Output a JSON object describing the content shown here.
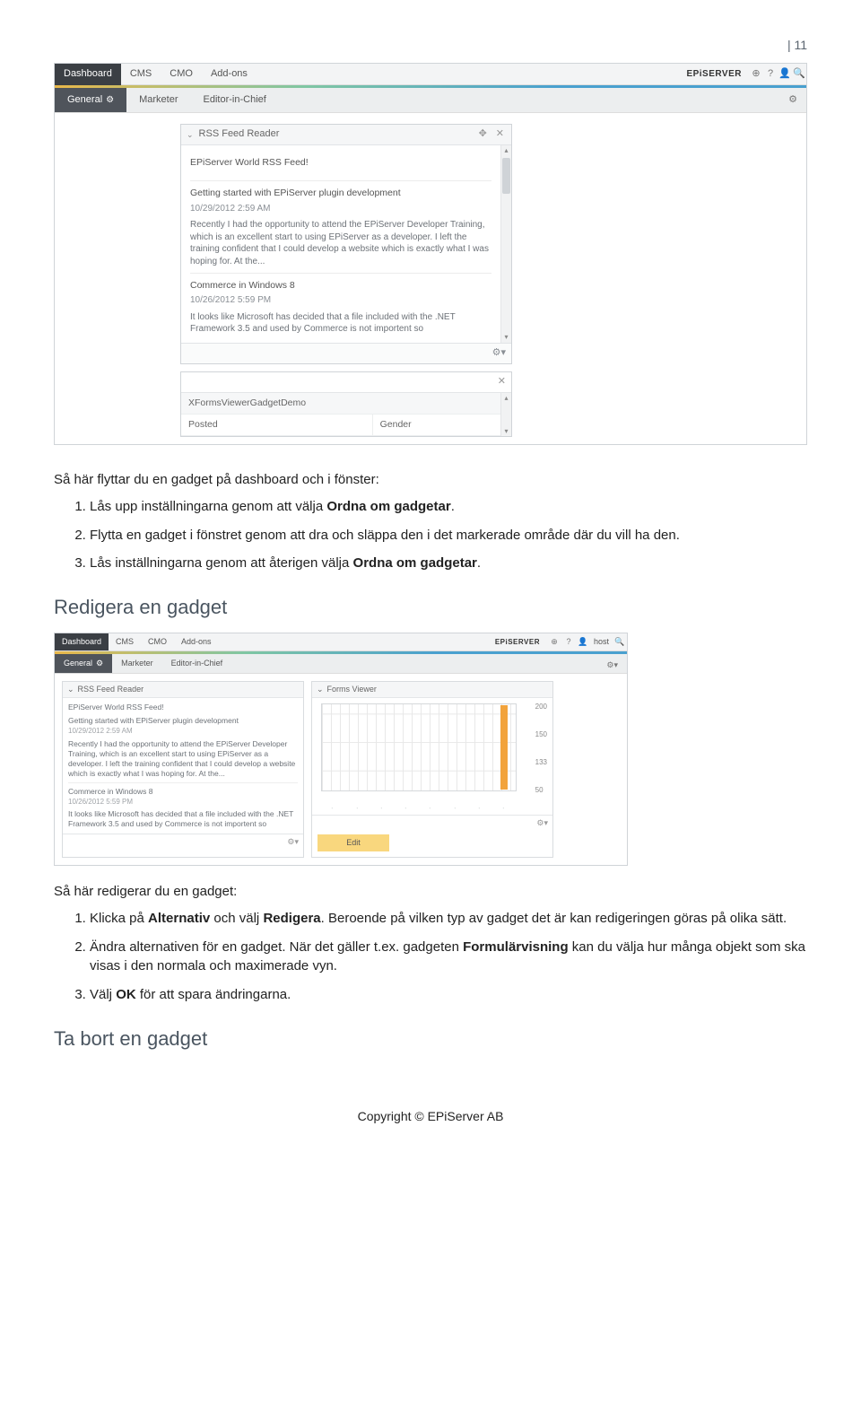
{
  "page_number": "| 11",
  "screenshot1": {
    "nav": {
      "dashboard": "Dashboard",
      "cms": "CMS",
      "cmo": "CMO",
      "addons": "Add-ons",
      "brand": "EPiSERVER"
    },
    "subnav": {
      "general": "General",
      "marketer": "Marketer",
      "editor": "Editor-in-Chief"
    },
    "panel": {
      "title": "RSS Feed Reader",
      "feed_title": "EPiServer World RSS Feed!",
      "item1_title": "Getting started with EPiServer plugin development",
      "item1_date": "10/29/2012 2:59 AM",
      "item1_text": "Recently I had the opportunity to attend the EPiServer Developer Training, which is an excellent start to using EPiServer as a developer.  I left the training confident that I could develop a website which is exactly what I was hoping for.  At the...",
      "item2_title": "Commerce in Windows 8",
      "item2_date": "10/26/2012 5:59 PM",
      "item2_text": "It looks like Microsoft has decided that a file included with the .NET Framework 3.5 and used by Commerce is not importent so"
    },
    "panel2": {
      "row1": "XFormsViewerGadgetDemo",
      "row2a": "Posted",
      "row2b": "Gender"
    }
  },
  "text": {
    "intro1": "Så här flyttar du en gadget på dashboard och i fönster:",
    "step1a": "Lås upp inställningarna genom att välja ",
    "step1b": "Ordna om gadgetar",
    "step1c": ".",
    "step2": "Flytta en gadget i fönstret genom att dra och släppa den i det markerade område där du vill ha den.",
    "step3a": "Lås inställningarna genom att återigen välja ",
    "step3b": "Ordna om gadgetar",
    "step3c": "."
  },
  "heading2": "Redigera en gadget",
  "screenshot2": {
    "nav": {
      "dashboard": "Dashboard",
      "cms": "CMS",
      "cmo": "CMO",
      "addons": "Add-ons",
      "brand": "EPiSERVER",
      "user": "host"
    },
    "subnav": {
      "general": "General",
      "marketer": "Marketer",
      "editor": "Editor-in-Chief"
    },
    "left_panel": {
      "title": "RSS Feed Reader",
      "feed_title": "EPiServer World RSS Feed!",
      "item1_title": "Getting started with EPiServer plugin development",
      "item1_date": "10/29/2012 2:59 AM",
      "item1_text": "Recently I had the opportunity to attend the EPiServer Developer Training, which is an excellent start to using EPiServer as a developer.  I left the training confident that I could develop a website which is exactly what I was hoping for.  At the...",
      "item2_title": "Commerce in Windows 8",
      "item2_date": "10/26/2012 5:59 PM",
      "item2_text": "It looks like Microsoft has decided that a file included with the .NET Framework 3.5 and used by Commerce is not importent so"
    },
    "right_panel": {
      "title": "Forms Viewer",
      "y": [
        "200",
        "150",
        "133",
        "50"
      ],
      "edit": "Edit"
    }
  },
  "text2": {
    "intro": "Så här redigerar du en gadget:",
    "s1a": "Klicka på ",
    "s1b": "Alternativ",
    "s1c": " och välj ",
    "s1d": "Redigera",
    "s1e": ". Beroende på vilken typ av gadget det är kan redigeringen göras på olika sätt.",
    "s2a": "Ändra alternativen för en gadget. När det gäller t.ex. gadgeten ",
    "s2b": "Formulärvisning",
    "s2c": " kan du välja hur många objekt som ska visas i den normala och maximerade vyn.",
    "s3a": "Välj ",
    "s3b": "OK",
    "s3c": " för att spara ändringarna."
  },
  "heading3": "Ta bort en gadget",
  "footer": "Copyright © EPiServer AB",
  "chart_data": {
    "type": "bar",
    "categories": [
      "",
      "",
      "",
      "",
      "",
      "",
      "",
      "",
      "",
      "",
      "",
      ""
    ],
    "values": [
      0,
      0,
      0,
      0,
      0,
      0,
      0,
      0,
      0,
      0,
      200,
      0
    ],
    "title": "Forms Viewer",
    "xlabel": "",
    "ylabel": "",
    "ylim": [
      0,
      200
    ],
    "yticks": [
      200,
      150,
      133,
      50
    ]
  }
}
